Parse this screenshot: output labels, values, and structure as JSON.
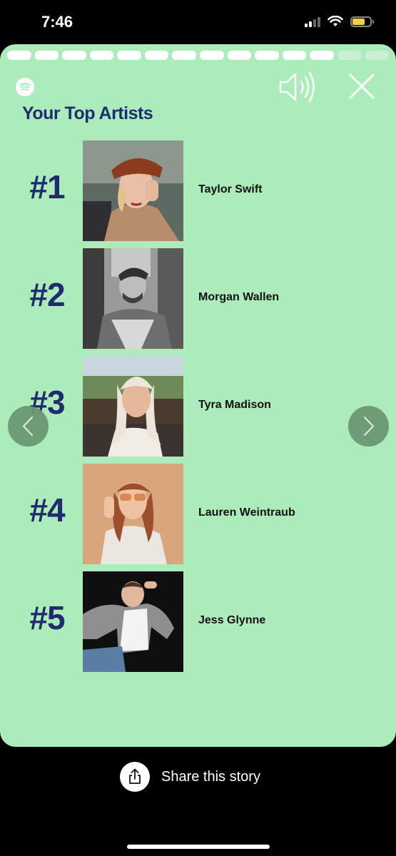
{
  "status_bar": {
    "time": "7:46",
    "battery_level": 0.75
  },
  "story": {
    "progress": {
      "total_segments": 14,
      "filled_segments": 12
    },
    "heading": "Your Top Artists",
    "artists": [
      {
        "rank": "#1",
        "name": "Taylor Swift"
      },
      {
        "rank": "#2",
        "name": "Morgan Wallen"
      },
      {
        "rank": "#3",
        "name": "Tyra Madison"
      },
      {
        "rank": "#4",
        "name": "Lauren Weintraub"
      },
      {
        "rank": "#5",
        "name": "Jess Glynne"
      }
    ],
    "icons": {
      "logo": "spotify-icon",
      "sound": "speaker-icon",
      "close": "close-icon",
      "prev": "chevron-left-icon",
      "next": "chevron-right-icon"
    },
    "colors": {
      "background": "#acecbb",
      "rank": "#1f2b6e",
      "heading": "#1e2e73"
    }
  },
  "share": {
    "label": "Share this story",
    "icon": "share-icon"
  }
}
